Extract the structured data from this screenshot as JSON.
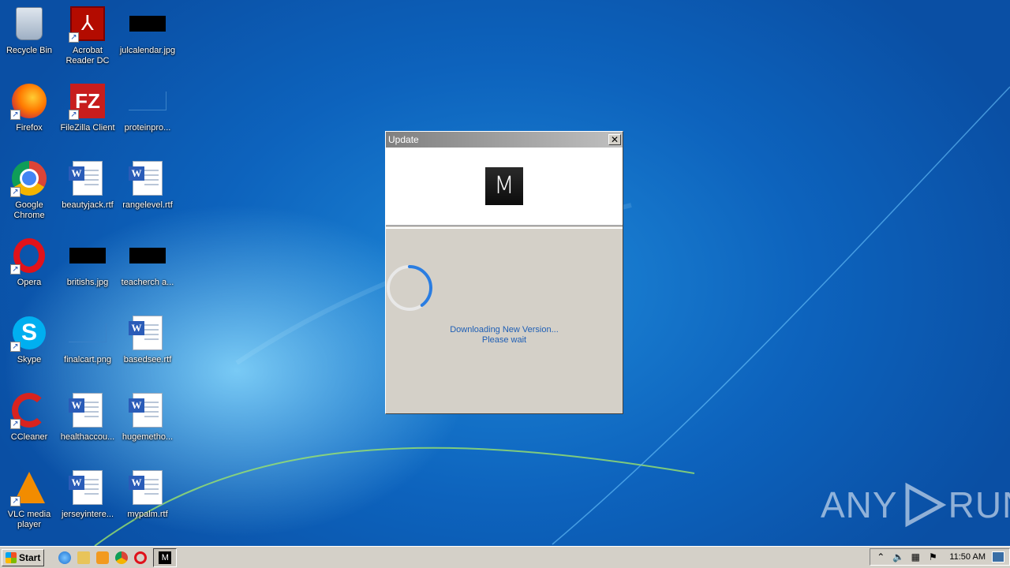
{
  "desktop": {
    "icons": [
      {
        "label": "Recycle Bin",
        "name": "recycle-bin-icon"
      },
      {
        "label": "Acrobat Reader DC",
        "name": "acrobat-reader-icon"
      },
      {
        "label": "julcalendar.jpg",
        "name": "julcalendar-file-icon"
      },
      {
        "label": "Firefox",
        "name": "firefox-icon"
      },
      {
        "label": "FileZilla Client",
        "name": "filezilla-icon"
      },
      {
        "label": "proteinpro...",
        "name": "proteinpro-file-icon"
      },
      {
        "label": "Google Chrome",
        "name": "chrome-icon"
      },
      {
        "label": "beautyjack.rtf",
        "name": "beautyjack-file-icon"
      },
      {
        "label": "rangelevel.rtf",
        "name": "rangelevel-file-icon"
      },
      {
        "label": "Opera",
        "name": "opera-icon"
      },
      {
        "label": "britishs.jpg",
        "name": "britishs-file-icon"
      },
      {
        "label": "teacherch a...",
        "name": "teacherch-file-icon"
      },
      {
        "label": "Skype",
        "name": "skype-icon"
      },
      {
        "label": "finalcart.png",
        "name": "finalcart-file-icon"
      },
      {
        "label": "basedsee.rtf",
        "name": "basedsee-file-icon"
      },
      {
        "label": "CCleaner",
        "name": "ccleaner-icon"
      },
      {
        "label": "healthaccou...",
        "name": "healthaccou-file-icon"
      },
      {
        "label": "hugemetho...",
        "name": "hugemetho-file-icon"
      },
      {
        "label": "VLC media player",
        "name": "vlc-icon"
      },
      {
        "label": "jerseyintere...",
        "name": "jerseyintere-file-icon"
      },
      {
        "label": "mypalm.rtf",
        "name": "mypalm-file-icon"
      }
    ]
  },
  "dialog": {
    "title": "Update",
    "close_glyph": "✕",
    "logo_letter": "M",
    "status_line1": "Downloading New Version...",
    "status_line2": "Please wait",
    "spinner_progress": 0.4
  },
  "watermark": {
    "left": "ANY",
    "right": "RUN"
  },
  "taskbar": {
    "start_label": "Start",
    "task_letter": "M",
    "clock": "11:50 AM"
  },
  "colors": {
    "accent": "#1f5fb5",
    "spinner": "#2a7de1"
  }
}
